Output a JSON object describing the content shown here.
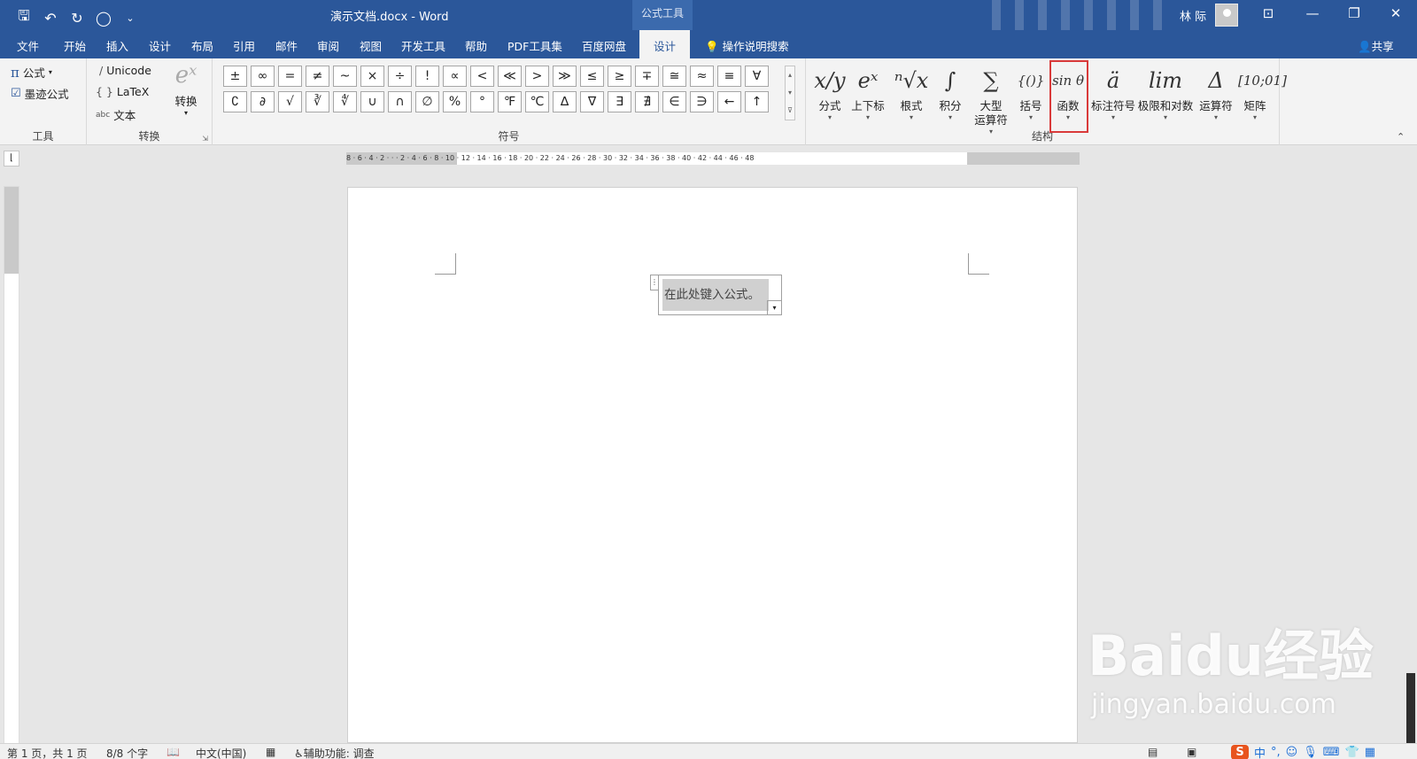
{
  "titlebar": {
    "doc_title": "演示文档.docx - Word",
    "context_tools": "公式工具",
    "user_name": "林 际",
    "qat_save": "🖫",
    "qat_undo": "↶",
    "qat_redo": "↻",
    "qat_circle": "◯",
    "qat_more": "⌄"
  },
  "tabs": [
    "文件",
    "开始",
    "插入",
    "设计",
    "布局",
    "引用",
    "邮件",
    "审阅",
    "视图",
    "开发工具",
    "帮助",
    "PDF工具集",
    "百度网盘"
  ],
  "active_tab": "设计",
  "tell_me": "操作说明搜索",
  "share": "共享",
  "tools_group": {
    "label": "工具",
    "equation": "公式",
    "ink": "墨迹公式"
  },
  "convert_group": {
    "label": "转换",
    "unicode": "Unicode",
    "latex": "LaTeX",
    "text": "文本",
    "text_prefix": "abc",
    "convert_btn": "转换"
  },
  "symbols_group": {
    "label": "符号",
    "row1": [
      "±",
      "∞",
      "=",
      "≠",
      "~",
      "×",
      "÷",
      "!",
      "∝",
      "<",
      "≪",
      ">",
      "≫",
      "≤",
      "≥",
      "∓",
      "≅",
      "≈",
      "≡",
      "∀"
    ],
    "row2": [
      "∁",
      "∂",
      "√",
      "∛",
      "∜",
      "∪",
      "∩",
      "∅",
      "%",
      "°",
      "℉",
      "℃",
      "∆",
      "∇",
      "∃",
      "∄",
      "∈",
      "∋",
      "←",
      "↑"
    ]
  },
  "structures_group": {
    "label": "结构",
    "items": [
      {
        "glyph": "x/y",
        "label": "分式"
      },
      {
        "glyph": "eˣ",
        "label": "上下标"
      },
      {
        "glyph": "ⁿ√x",
        "label": "根式"
      },
      {
        "glyph": "∫",
        "label": "积分"
      },
      {
        "glyph": "∑",
        "label": "大型",
        "label2": "运算符"
      },
      {
        "glyph": "{()}",
        "label": "括号"
      },
      {
        "glyph": "sin θ",
        "label": "函数"
      },
      {
        "glyph": "ä",
        "label": "标注符号"
      },
      {
        "glyph": "lim",
        "label": "极限和对数"
      },
      {
        "glyph": "Δ",
        "label": "运算符"
      },
      {
        "glyph": "[10;01]",
        "label": "矩阵"
      }
    ]
  },
  "document": {
    "equation_placeholder": "在此处键入公式。"
  },
  "status": {
    "page": "第 1 页，共 1 页",
    "words": "8/8 个字",
    "language": "中文(中国)",
    "accessibility": "辅助功能: 调查"
  },
  "watermark": {
    "logo": "Baidu经验",
    "url": "jingyan.baidu.com"
  },
  "ruler_ticks": "8 · 6 · 4 · 2 · · · 2 · 4 · 6 · 8 · 10 · 12 · 14 · 16 · 18 · 20 · 22 · 24 · 26 · 28 · 30 · 32 · 34 · 36 · 38 · 40 · 42 · 44 · 46 · 48",
  "colors": {
    "word_blue": "#2b579a",
    "highlight_red": "#d93a3a"
  }
}
